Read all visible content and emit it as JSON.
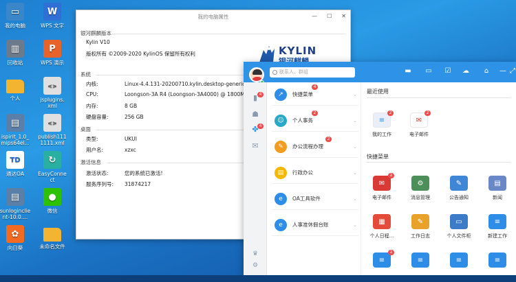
{
  "desktop": {
    "icons": [
      {
        "label": "我的电脑",
        "icon": "computer-icon",
        "color": "#3a86c9"
      },
      {
        "label": "WPS 文字",
        "icon": "wps-writer-icon",
        "color": "#2f6fd6"
      },
      {
        "label": "回收站",
        "icon": "trash-icon",
        "color": "#6b7b8c"
      },
      {
        "label": "WPS 演示",
        "icon": "wps-presentation-icon",
        "color": "#e8622c"
      },
      {
        "label": "个人",
        "icon": "folder-icon",
        "color": "#f2b431"
      },
      {
        "label": "jsplugins.\nxml",
        "icon": "xml-file-icon",
        "color": "#e0e0e0"
      },
      {
        "label": "ispirit_1.0_\nmips64el...",
        "icon": "package-icon",
        "color": "#5a7fa8"
      },
      {
        "label": "publish111\n1111.xml",
        "icon": "xml-file-icon",
        "color": "#e0e0e0"
      },
      {
        "label": "通达OA",
        "icon": "tongda-oa-icon",
        "color": "#ffffff"
      },
      {
        "label": "EasyConne\nct",
        "icon": "easyconnect-icon",
        "color": "#2ab0a0"
      },
      {
        "label": "sunloginclie\nnt-10.0....",
        "icon": "package-icon",
        "color": "#5a7fa8"
      },
      {
        "label": "微信",
        "icon": "wechat-icon",
        "color": "#2dc100"
      },
      {
        "label": "向日葵",
        "icon": "sunflower-icon",
        "color": "#f36b21"
      },
      {
        "label": "未命名文件",
        "icon": "folder-icon",
        "color": "#f2b431"
      }
    ]
  },
  "props": {
    "title": "我的电脑属性",
    "min": "—",
    "max": "☐",
    "close": "✕",
    "version_section": "银河麒麟版本",
    "version": "Kylin V10",
    "copyright": "版权所有 ©2009-2020 KylinOS 保留所有权利",
    "logo_text": "KYLIN",
    "logo_sub": "银河麒麟",
    "system_section": "系统",
    "system": [
      {
        "k": "内核:",
        "v": "Linux-4.4.131-20200710.kylin.desktop-generic-mips"
      },
      {
        "k": "CPU:",
        "v": "Loongson-3A R4 (Loongson-3A4000) @ 1800MHz"
      },
      {
        "k": "内存:",
        "v": "8 GB"
      },
      {
        "k": "硬盘容量:",
        "v": "256 GB"
      }
    ],
    "desktop_section": "桌面",
    "desktop": [
      {
        "k": "类型:",
        "v": "UKUI"
      },
      {
        "k": "用户名:",
        "v": "xzxc"
      }
    ],
    "activation_section": "激活信息",
    "activation": [
      {
        "k": "激活状态:",
        "v": "您的系统已激活!"
      },
      {
        "k": "服务序列号:",
        "v": "31874217"
      }
    ]
  },
  "oa": {
    "search_placeholder": "联系人、群组",
    "side_badges": [
      "4",
      "4"
    ],
    "menu": [
      {
        "label": "快捷菜单",
        "badge": "4",
        "color": "#2e8de6",
        "icon": "↗"
      },
      {
        "label": "个人事务",
        "badge": "2",
        "color": "#2aa8c9",
        "icon": "☺"
      },
      {
        "label": "办公流程办理",
        "badge": "2",
        "color": "#f39c1f",
        "icon": "✎"
      },
      {
        "label": "行政办公",
        "badge": "",
        "color": "#f5b800",
        "icon": "▤"
      },
      {
        "label": "OA工具软件",
        "badge": "",
        "color": "#2e8de6",
        "icon": "e"
      },
      {
        "label": "人事准休假台账",
        "badge": "",
        "color": "#2e8de6",
        "icon": "e"
      }
    ],
    "recent_title": "最近使用",
    "recent": [
      {
        "label": "我的工作",
        "badge": "2",
        "color": "#e9eef8",
        "icon": "workflow-icon"
      },
      {
        "label": "电子邮件",
        "badge": "2",
        "color": "#ffffff",
        "icon": "mail-icon"
      }
    ],
    "quick_title": "快捷菜单",
    "quick": [
      {
        "label": "电子邮件",
        "badge": "2",
        "icon": "mail-icon",
        "color": "#d93a35"
      },
      {
        "label": "消息管理",
        "badge": "",
        "icon": "message-gear-icon",
        "color": "#4c8f5a"
      },
      {
        "label": "公告通知",
        "badge": "",
        "icon": "notice-icon",
        "color": "#3f86d6"
      },
      {
        "label": "新闻",
        "badge": "",
        "icon": "news-icon",
        "color": "#6a88c8"
      },
      {
        "label": "个人日程...",
        "badge": "",
        "icon": "calendar-icon",
        "color": "#e44b3a"
      },
      {
        "label": "工作日志",
        "badge": "",
        "icon": "log-icon",
        "color": "#e8a22a"
      },
      {
        "label": "个人文件柜",
        "badge": "",
        "icon": "file-cabinet-icon",
        "color": "#3b7bc8"
      },
      {
        "label": "新建工作",
        "badge": "",
        "icon": "new-work-icon",
        "color": "#2e8de6"
      },
      {
        "label": "",
        "badge": "2",
        "icon": "workflow-icon",
        "color": "#2e8de6"
      },
      {
        "label": "",
        "badge": "",
        "icon": "workflow-icon",
        "color": "#2e8de6"
      },
      {
        "label": "",
        "badge": "",
        "icon": "workflow-icon",
        "color": "#2e8de6"
      },
      {
        "label": "",
        "badge": "",
        "icon": "workflow-icon",
        "color": "#2e8de6"
      }
    ]
  }
}
